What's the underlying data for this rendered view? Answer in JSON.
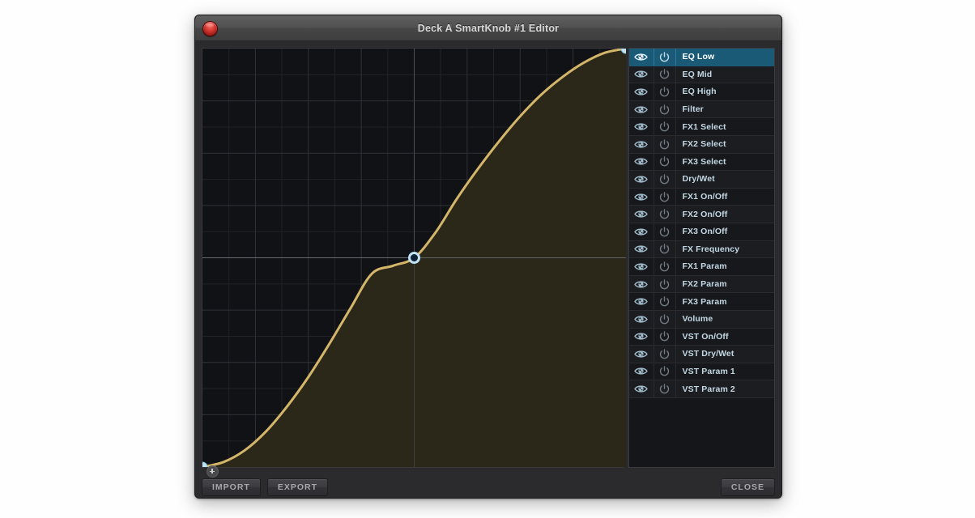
{
  "window": {
    "title": "Deck A SmartKnob #1 Editor",
    "close_dot_name": "close-window-dot",
    "accent_selected": "#1b5a77",
    "curve_color": "#d4b66a",
    "fill_color": "#2b2819",
    "plot_bg": "#111216",
    "handle_color": "#bfe2f5"
  },
  "curve_editor": {
    "add_point_label": "+"
  },
  "chart_data": {
    "type": "line",
    "title": "SmartKnob response curve",
    "xlabel": "",
    "ylabel": "",
    "xlim": [
      0,
      1
    ],
    "ylim": [
      0,
      1
    ],
    "grid": true,
    "legend": "none",
    "curve_kind": "ease-in-out S-curve",
    "control_points": [
      {
        "x": 0.0,
        "y": 0.0,
        "style": "filled"
      },
      {
        "x": 0.5,
        "y": 0.5,
        "style": "ring"
      },
      {
        "x": 1.0,
        "y": 1.0,
        "style": "filled"
      }
    ],
    "x": [
      0.0,
      0.05,
      0.1,
      0.15,
      0.2,
      0.25,
      0.3,
      0.35,
      0.4,
      0.45,
      0.5,
      0.55,
      0.6,
      0.65,
      0.7,
      0.75,
      0.8,
      0.85,
      0.9,
      0.95,
      1.0
    ],
    "y": [
      0.0,
      0.012,
      0.04,
      0.085,
      0.145,
      0.215,
      0.295,
      0.38,
      0.462,
      0.481,
      0.5,
      0.56,
      0.64,
      0.712,
      0.778,
      0.838,
      0.89,
      0.932,
      0.966,
      0.99,
      1.0
    ],
    "grid_major_divisions": 8,
    "grid_minor_divisions": 16,
    "midline_emphasis": true
  },
  "param_list": {
    "columns": [
      "visibility",
      "enable",
      "name"
    ],
    "selected_index": 0,
    "rows": [
      {
        "label": "EQ Low"
      },
      {
        "label": "EQ Mid"
      },
      {
        "label": "EQ High"
      },
      {
        "label": "Filter"
      },
      {
        "label": "FX1 Select"
      },
      {
        "label": "FX2 Select"
      },
      {
        "label": "FX3 Select"
      },
      {
        "label": "Dry/Wet"
      },
      {
        "label": "FX1 On/Off"
      },
      {
        "label": "FX2 On/Off"
      },
      {
        "label": "FX3 On/Off"
      },
      {
        "label": "FX Frequency"
      },
      {
        "label": "FX1 Param"
      },
      {
        "label": "FX2 Param"
      },
      {
        "label": "FX3 Param"
      },
      {
        "label": "Volume"
      },
      {
        "label": "VST On/Off"
      },
      {
        "label": "VST Dry/Wet"
      },
      {
        "label": "VST Param 1"
      },
      {
        "label": "VST Param 2"
      }
    ],
    "icons": {
      "visibility": "eye-icon",
      "enable": "power-icon"
    }
  },
  "footer": {
    "import_label": "IMPORT",
    "export_label": "EXPORT",
    "close_label": "CLOSE"
  }
}
